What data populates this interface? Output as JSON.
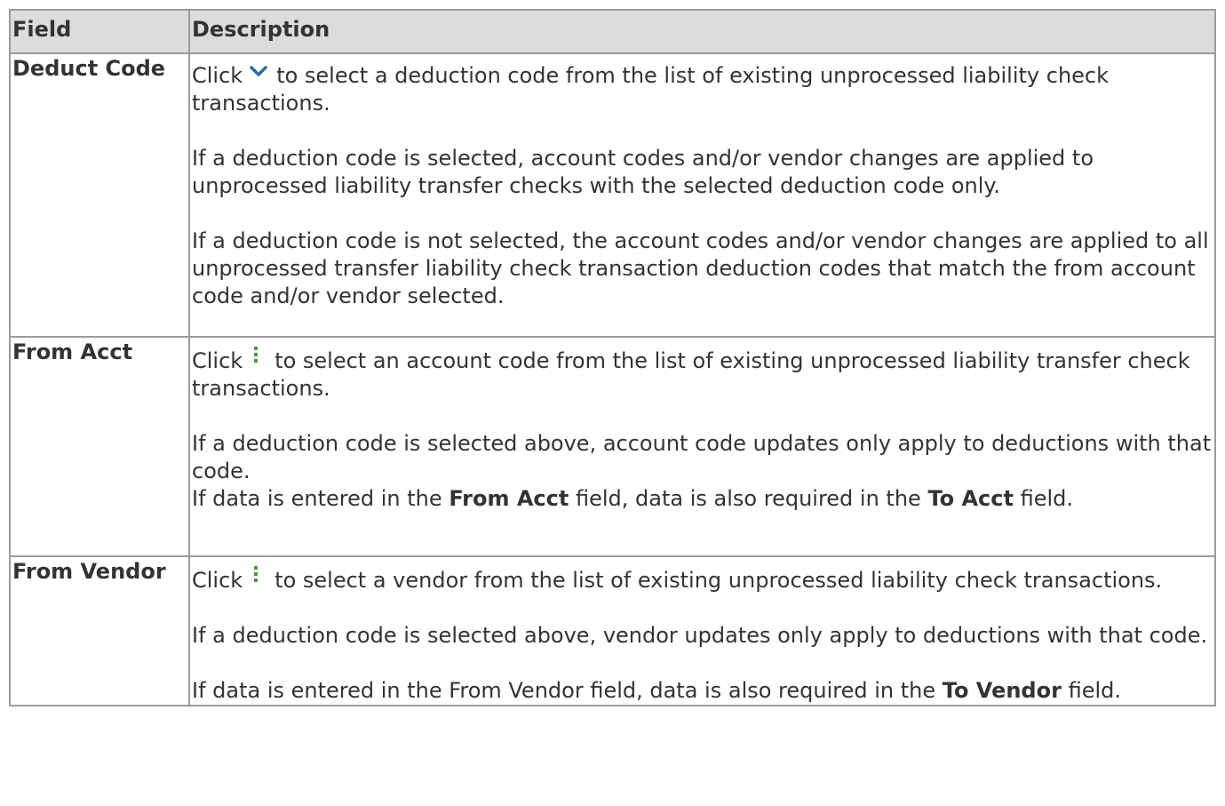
{
  "headers": {
    "field": "Field",
    "description": "Description"
  },
  "rows": [
    {
      "field": "Deduct Code",
      "paragraphs": {
        "p1_pre": "Click",
        "p1_icon": "chevron-down-icon",
        "p1_post": "to select a deduction code from the list of existing unprocessed liability check transactions.",
        "p2": "If a deduction code is selected, account codes and/or vendor changes are applied to unprocessed liability transfer checks with the selected deduction code only.",
        "p3": "If a deduction code is not selected, the account codes and/or vendor changes are applied to all unprocessed transfer liability check transaction deduction codes that match the from account code and/or vendor selected."
      }
    },
    {
      "field": "From Acct",
      "paragraphs": {
        "p1_pre": "Click",
        "p1_icon": "vertical-dots-icon",
        "p1_post": "to select an account code from the list of existing unprocessed liability transfer check transactions.",
        "p2": "If a deduction code is selected above, account code updates only apply to deductions with that code.",
        "p3_a": "If data is entered in the",
        "p3_b": "From Acct",
        "p3_c": "field, data is also required in the",
        "p3_d": "To Acct",
        "p3_e": "field."
      }
    },
    {
      "field": "From Vendor",
      "paragraphs": {
        "p1_pre": "Click",
        "p1_icon": "vertical-dots-icon",
        "p1_post": "to select a vendor from the list of existing unprocessed liability check transactions.",
        "p2": "If a deduction code is selected above, vendor updates only apply to deductions with that code.",
        "p3_a": "If data is entered in the From Vendor field, data is also required in the",
        "p3_b": "To Vendor",
        "p3_c": "field."
      }
    }
  ],
  "colors": {
    "border": "#9b9b9b",
    "header_bg": "#dcdcdc",
    "text": "#333333",
    "icon_chevron": "#2c6d9e",
    "icon_dots": "#4a9a3a"
  }
}
